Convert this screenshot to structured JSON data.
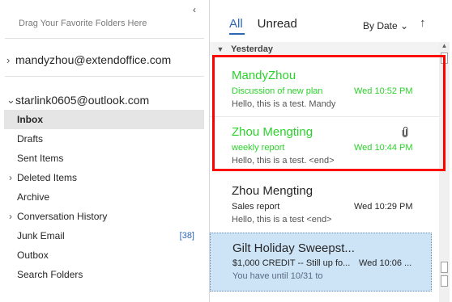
{
  "folder_pane": {
    "favorites_hint": "Drag Your Favorite Folders Here",
    "accounts": [
      {
        "name": "mandyzhou@extendoffice.com"
      },
      {
        "name": "starlink0605@outlook.com"
      }
    ],
    "folders": [
      {
        "label": "Inbox",
        "selected": true
      },
      {
        "label": "Drafts"
      },
      {
        "label": "Sent Items"
      },
      {
        "label": "Deleted Items",
        "expandable": true
      },
      {
        "label": "Archive"
      },
      {
        "label": "Conversation History",
        "expandable": true
      },
      {
        "label": "Junk Email",
        "count": "[38]"
      },
      {
        "label": "Outbox"
      },
      {
        "label": "Search Folders"
      }
    ]
  },
  "list": {
    "tabs": [
      {
        "label": "All",
        "active": true
      },
      {
        "label": "Unread"
      }
    ],
    "sort_label": "By Date",
    "group_label": "Yesterday",
    "messages": [
      {
        "sender": "MandyZhou",
        "subject": "Discussion of new plan",
        "time": "Wed 10:52 PM",
        "preview": "Hello, this is a test.  Mandy",
        "color": "#2bd22b"
      },
      {
        "sender": "Zhou Mengting",
        "subject": "weekly report",
        "time": "Wed 10:44 PM",
        "preview": "Hello, this is a test. <end>",
        "color": "#2bd22b",
        "attachment": true
      },
      {
        "sender": "Zhou Mengting",
        "subject": "Sales report",
        "time": "Wed 10:29 PM",
        "preview": "Hello, this is a test <end>"
      },
      {
        "sender": "Gilt Holiday Sweepst...",
        "subject": "$1,000 CREDIT -- Still up fo...",
        "time": "Wed 10:06 ...",
        "preview": "You have until 10/31 to"
      }
    ]
  },
  "colors": {
    "accent": "#2b66b8",
    "highlight_box": "#ff0000",
    "green_text": "#2bd22b",
    "selected_row": "#cde3f6"
  }
}
